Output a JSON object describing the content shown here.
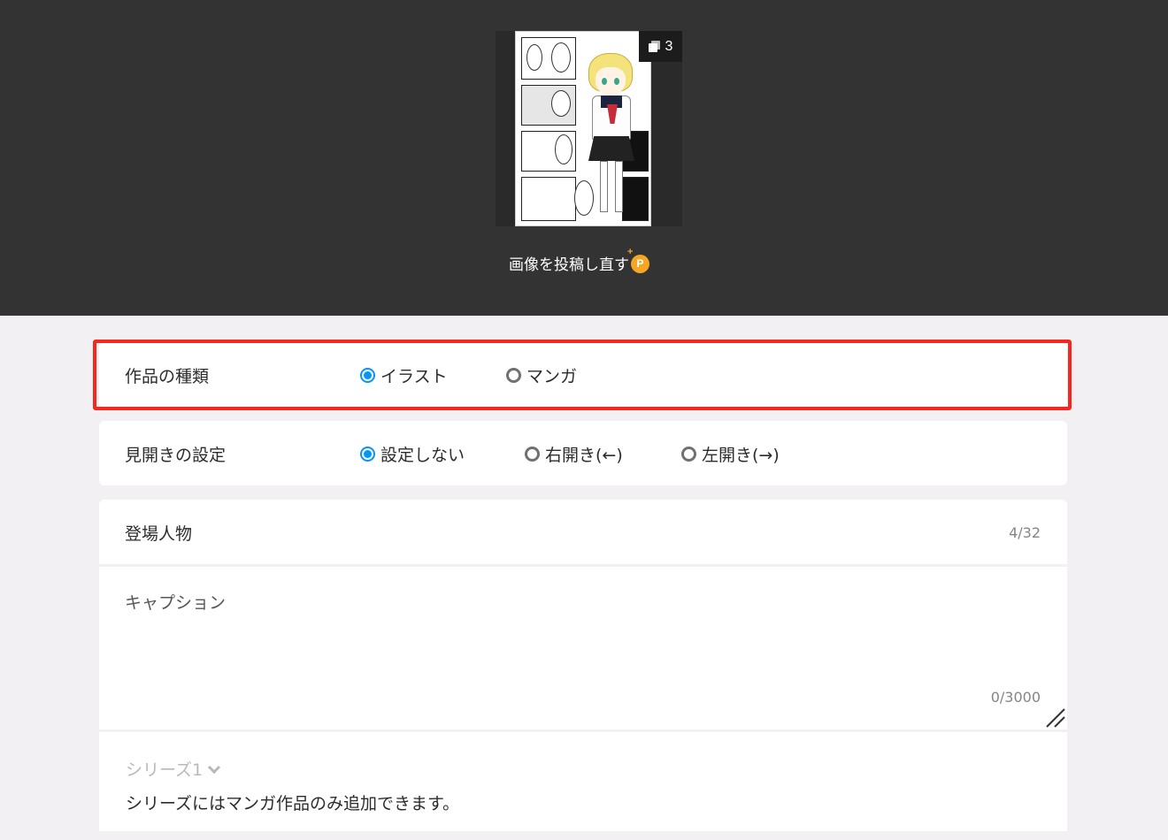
{
  "preview": {
    "page_count": "3",
    "repost_label": "画像を投稿し直す",
    "premium_icon": "premium-p-icon"
  },
  "work_type": {
    "label": "作品の種類",
    "options": [
      {
        "label": "イラスト",
        "checked": true
      },
      {
        "label": "マンガ",
        "checked": false
      }
    ]
  },
  "spread": {
    "label": "見開きの設定",
    "options": [
      {
        "label": "設定しない",
        "checked": true
      },
      {
        "label": "右開き(←)",
        "checked": false
      },
      {
        "label": "左開き(→)",
        "checked": false
      }
    ]
  },
  "characters": {
    "label": "登場人物",
    "counter": "4/32"
  },
  "caption": {
    "placeholder": "キャプション",
    "counter": "0/3000"
  },
  "series": {
    "selected": "シリーズ1",
    "note": "シリーズにはマンガ作品のみ追加できます。"
  },
  "colors": {
    "accent": "#0096fa",
    "highlight": "#f5281f",
    "header_bg": "#333333"
  }
}
